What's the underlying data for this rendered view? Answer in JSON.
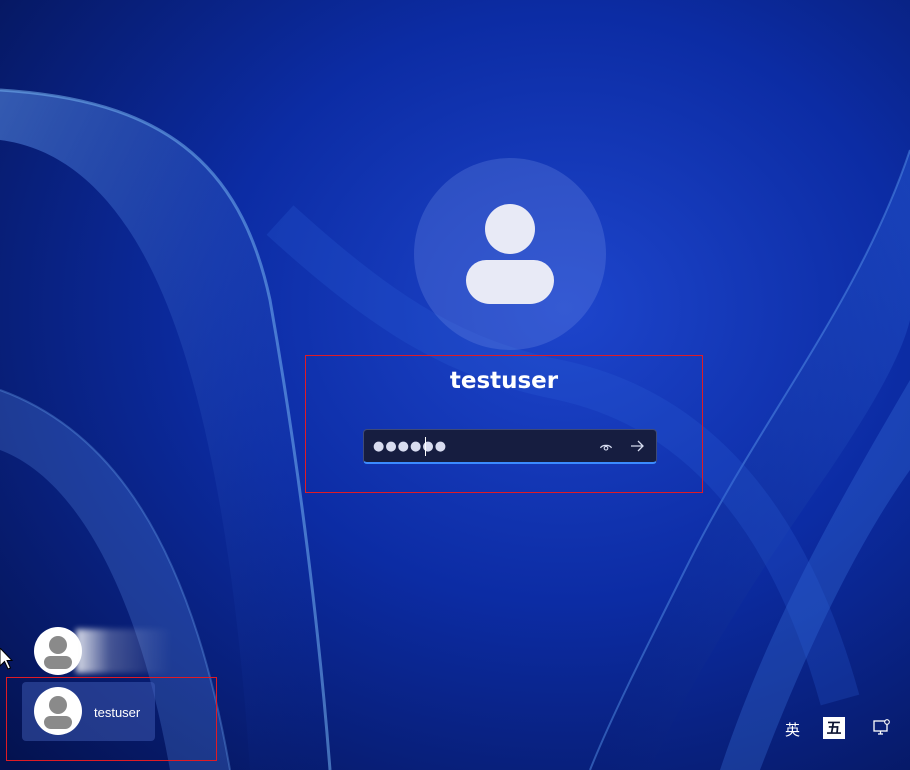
{
  "lockscreen": {
    "username": "testuser",
    "password_masked": "●●●●●●",
    "reveal_icon": "eye-icon",
    "submit_icon": "arrow-right-icon"
  },
  "user_switcher": {
    "users": [
      {
        "name": ""
      },
      {
        "name": "testuser"
      }
    ]
  },
  "tray": {
    "language_label": "英",
    "ime_label": "五",
    "accessibility_icon": "accessibility-icon"
  },
  "colors": {
    "accent": "#3b8bff",
    "highlight_border": "#e01b24",
    "background": "#0a2a9e"
  }
}
